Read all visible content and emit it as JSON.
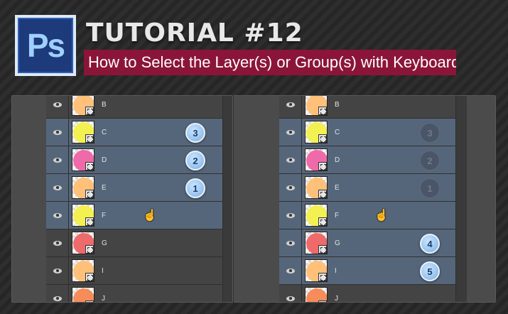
{
  "header": {
    "logo_text": "Ps",
    "title": "TUTORIAL #12",
    "subtitle": "How to Select the Layer(s) or Group(s) with Keyboard"
  },
  "colors": {
    "accent": "#8b1538",
    "selected_row": "#56667a",
    "badge": "#9fc9f2"
  },
  "left_panel": {
    "layers": [
      {
        "name": "B",
        "color": "#ffc07a",
        "shape": "corner",
        "selected": false,
        "badge": ""
      },
      {
        "name": "C",
        "color": "#f3f051",
        "shape": "corner",
        "selected": true,
        "badge": "3"
      },
      {
        "name": "D",
        "color": "#ef6aa8",
        "shape": "round",
        "selected": true,
        "badge": "2"
      },
      {
        "name": "E",
        "color": "#ffc07a",
        "shape": "corner",
        "selected": true,
        "badge": "1"
      },
      {
        "name": "F",
        "color": "#f3f051",
        "shape": "corner",
        "selected": true,
        "badge": ""
      },
      {
        "name": "G",
        "color": "#ef6a6a",
        "shape": "round",
        "selected": false,
        "badge": ""
      },
      {
        "name": "I",
        "color": "#ffc07a",
        "shape": "corner",
        "selected": false,
        "badge": ""
      },
      {
        "name": "J",
        "color": "#f58c5a",
        "shape": "round",
        "selected": false,
        "badge": ""
      }
    ]
  },
  "right_panel": {
    "layers": [
      {
        "name": "B",
        "color": "#ffc07a",
        "shape": "corner",
        "selected": false,
        "badge": ""
      },
      {
        "name": "C",
        "color": "#f3f051",
        "shape": "corner",
        "selected": true,
        "badge": "3",
        "faded": true
      },
      {
        "name": "D",
        "color": "#ef6aa8",
        "shape": "round",
        "selected": true,
        "badge": "2",
        "faded": true
      },
      {
        "name": "E",
        "color": "#ffc07a",
        "shape": "corner",
        "selected": true,
        "badge": "1",
        "faded": true
      },
      {
        "name": "F",
        "color": "#f3f051",
        "shape": "corner",
        "selected": true,
        "badge": ""
      },
      {
        "name": "G",
        "color": "#ef6a6a",
        "shape": "round",
        "selected": true,
        "badge": "4"
      },
      {
        "name": "I",
        "color": "#ffc07a",
        "shape": "corner",
        "selected": true,
        "badge": "5"
      },
      {
        "name": "J",
        "color": "#f58c5a",
        "shape": "round",
        "selected": false,
        "badge": ""
      }
    ]
  }
}
